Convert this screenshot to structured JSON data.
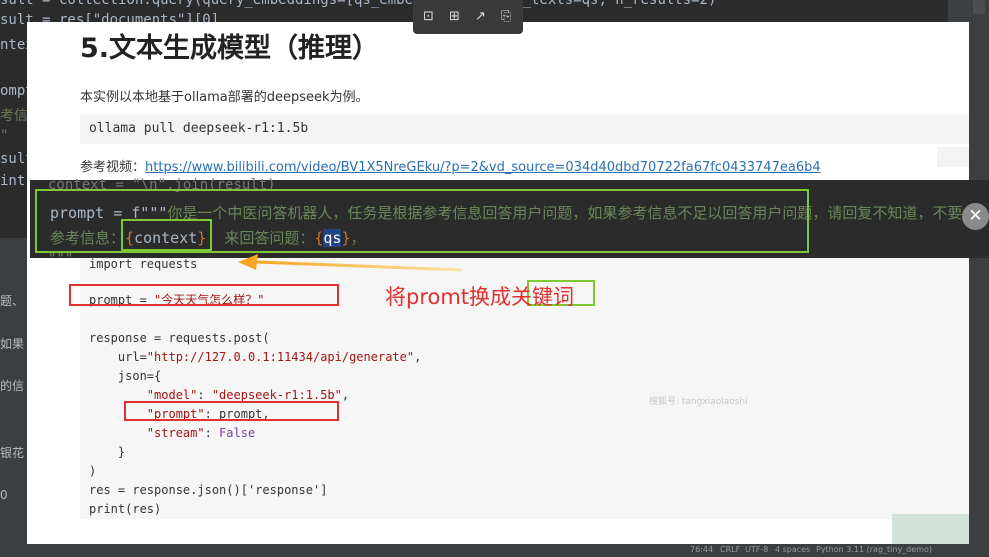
{
  "ide": {
    "lines": [
      "sult = collection.query(query_embeddings=[qs_embedding], query_texts=qs, n_results=2)",
      "sult = res[\"documents\"][0]",
      "ntex",
      "",
      "ompt",
      "考信息",
      "\"",
      "sult",
      "int("
    ],
    "left_snips": [
      "题、",
      "如果",
      "的信",
      "银花",
      "0"
    ],
    "right_tag": "ode",
    "toolbar_icons": [
      "⊡",
      "⊞",
      "↗",
      "⎘"
    ]
  },
  "doc": {
    "title": "5.文本生成模型（推理）",
    "intro": "本实例以本地基于ollama部署的deepseek为例。",
    "install_cmd": "ollama pull deepseek-r1:1.5b",
    "ref_label": "参考视频：",
    "ref_url": "https://www.bilibili.com/video/BV1X5NreGEku/?p=2&vd_source=034d40dbd70722fa67fc0433747ea6b4",
    "code": {
      "l1": "import requests",
      "l2a": "prompt = ",
      "l2b": "\"今天天气怎么样？\"",
      "l3": "response = requests.post(",
      "l4a": "    url=",
      "l4b": "\"http://127.0.0.1:11434/api/generate\"",
      "l4c": ",",
      "l5": "    json={",
      "l6a": "        ",
      "l6b": "\"model\"",
      "l6c": ": ",
      "l6d": "\"deepseek-r1:1.5b\"",
      "l6e": ",",
      "l7a": "        ",
      "l7b": "\"prompt\"",
      "l7c": ": prompt,",
      "l8a": "        ",
      "l8b": "\"stream\"",
      "l8c": ": ",
      "l8d": "False",
      "l9": "    }",
      "l10": ")",
      "l11": "res = response.json()['response']",
      "l12": "print(res)"
    },
    "watermark": "搜狐号: tangxiaolaoshi"
  },
  "overlay": {
    "prev_line": "context = \"\\n\".join(result)",
    "l1a": "prompt = f\"\"\"",
    "l1b": "你是一个中医问答机器人，任务是根据参考信息回答用户问题，如果参考信息不足以回答用户问题，请回复不知道，不要",
    "l2a": "参考信息：",
    "l2b": "{",
    "l2c": "context",
    "l2d": "}",
    "l2e": "  来回答问题：",
    "l2f": "{",
    "l2g": "qs",
    "l2h": "}",
    "l2i": "，",
    "tail": "\"\"\""
  },
  "annotation": {
    "text_a": "将promt换成",
    "text_b": "关键词",
    "color": "#e03030",
    "box_green": "#7ec832"
  },
  "close_glyph": "✕",
  "status": {
    "pos": "76:44",
    "eol": "CRLF",
    "enc": "UTF-8",
    "indent": "4 spaces",
    "interp": "Python 3.11 (rag_tiny_demo)"
  }
}
